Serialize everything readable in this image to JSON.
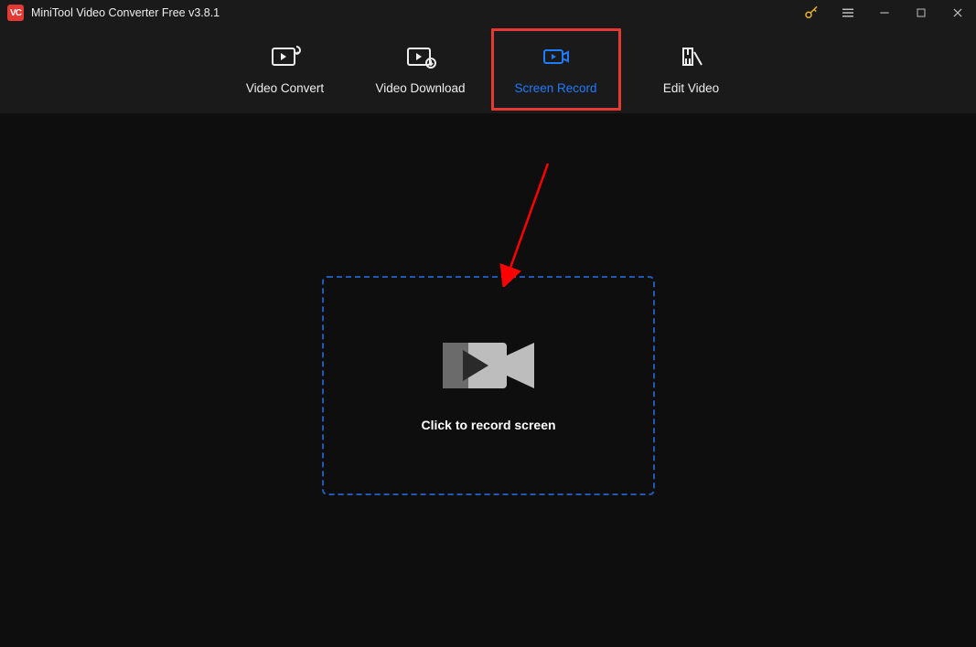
{
  "app": {
    "logo_text": "VC",
    "title": "MiniTool Video Converter Free v3.8.1"
  },
  "tabs": [
    {
      "label": "Video Convert"
    },
    {
      "label": "Video Download"
    },
    {
      "label": "Screen Record"
    },
    {
      "label": "Edit Video"
    }
  ],
  "main": {
    "drop_text": "Click to record screen"
  }
}
